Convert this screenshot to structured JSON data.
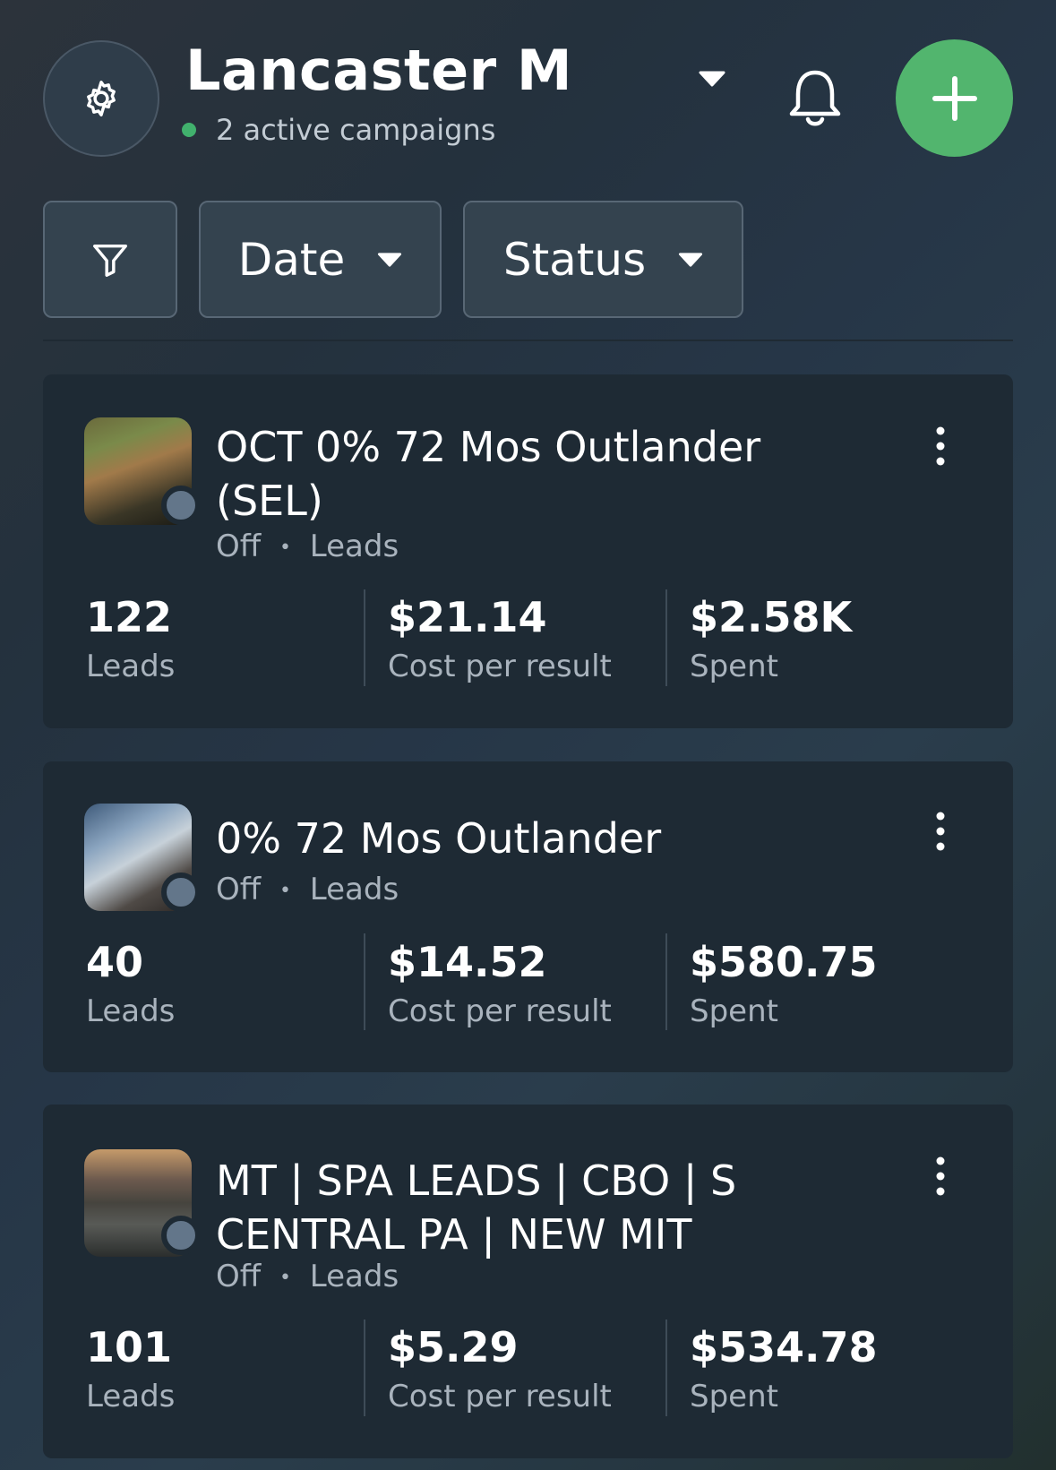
{
  "header": {
    "account_name": "Lancaster M",
    "active_campaigns": "2 active campaigns",
    "status_color": "#41b16d",
    "add_button_color": "#52b56e"
  },
  "filters": {
    "date_label": "Date",
    "status_label": "Status"
  },
  "campaigns": [
    {
      "title": "OCT 0% 72 Mos Outlander (SEL)",
      "status": "Off",
      "objective": "Leads",
      "results": "122",
      "results_label": "Leads",
      "cost_per_result": "$21.14",
      "cost_label": "Cost per result",
      "spent": "$2.58K",
      "spent_label": "Spent"
    },
    {
      "title": "0% 72 Mos Outlander",
      "status": "Off",
      "objective": "Leads",
      "results": "40",
      "results_label": "Leads",
      "cost_per_result": "$14.52",
      "cost_label": "Cost per result",
      "spent": "$580.75",
      "spent_label": "Spent"
    },
    {
      "title": "MT | SPA LEADS | CBO | S CENTRAL PA | NEW MIT",
      "status": "Off",
      "objective": "Leads",
      "results": "101",
      "results_label": "Leads",
      "cost_per_result": "$5.29",
      "cost_label": "Cost per result",
      "spent": "$534.78",
      "spent_label": "Spent"
    }
  ],
  "meta_separator": "•"
}
